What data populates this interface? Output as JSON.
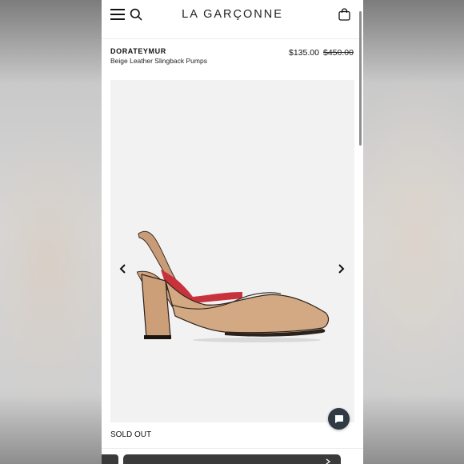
{
  "header": {
    "logo": "LA GARÇONNE",
    "menu_icon": "hamburger-menu-icon",
    "search_icon": "search-icon",
    "bag_icon": "shopping-bag-icon"
  },
  "product": {
    "brand": "DORATEYMUR",
    "name": "Beige Leather Slingback Pumps",
    "sale_price": "$135.00",
    "original_price": "$450.00",
    "status": "SOLD OUT"
  },
  "gallery": {
    "prev_icon": "chevron-left-icon",
    "next_icon": "chevron-right-icon",
    "image": "beige-slingback-pump"
  },
  "chat": {
    "icon": "chat-bubble-icon"
  },
  "colors": {
    "text": "#111111",
    "gallery_bg": "#f2f2f2",
    "chat_button": "#2f3a45",
    "bottom_bar": "#3a3a3a",
    "shoe_beige": "#d3a983",
    "shoe_lining": "#c8323c"
  }
}
